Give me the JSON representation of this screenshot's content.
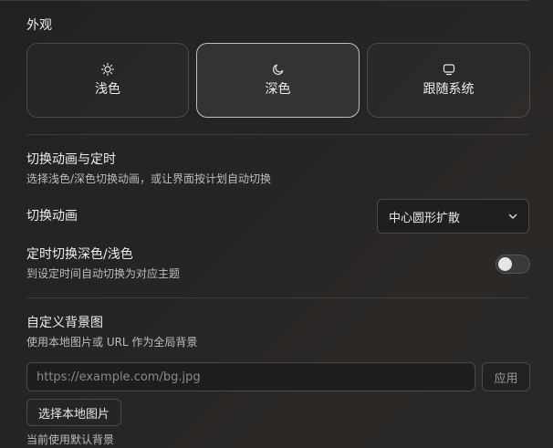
{
  "appearance": {
    "title": "外观",
    "themes": [
      {
        "label": "浅色",
        "icon": "sun-icon",
        "active": false
      },
      {
        "label": "深色",
        "icon": "moon-icon",
        "active": true
      },
      {
        "label": "跟随系统",
        "icon": "monitor-icon",
        "active": false
      }
    ]
  },
  "animation": {
    "title": "切换动画与定时",
    "description": "选择浅色/深色切换动画，或让界面按计划自动切换",
    "switch_animation_label": "切换动画",
    "switch_animation_value": "中心圆形扩散",
    "schedule_label": "定时切换深色/浅色",
    "schedule_description": "到设定时间自动切换为对应主题",
    "schedule_enabled": false
  },
  "background": {
    "title": "自定义背景图",
    "description": "使用本地图片或 URL 作为全局背景",
    "url_placeholder": "https://example.com/bg.jpg",
    "url_value": "",
    "apply_label": "应用",
    "pick_local_label": "选择本地图片",
    "status": "当前使用默认背景"
  }
}
